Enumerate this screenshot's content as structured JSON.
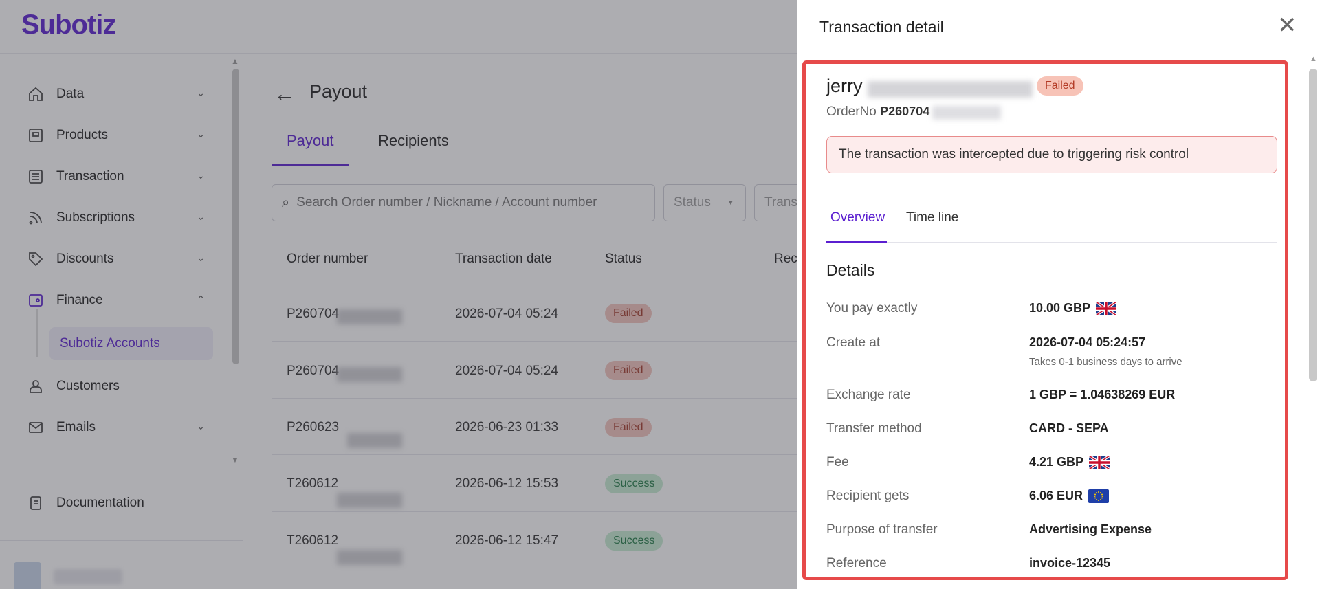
{
  "brand": {
    "name": "Subotiz"
  },
  "sidebar": {
    "items": [
      {
        "label": "Data"
      },
      {
        "label": "Products"
      },
      {
        "label": "Transaction"
      },
      {
        "label": "Subscriptions"
      },
      {
        "label": "Discounts"
      },
      {
        "label": "Finance"
      },
      {
        "label": "Customers"
      },
      {
        "label": "Emails"
      },
      {
        "label": "Documentation"
      }
    ],
    "sub_item": "Subotiz Accounts"
  },
  "main": {
    "title": "Payout",
    "tabs": [
      {
        "label": "Payout"
      },
      {
        "label": "Recipients"
      }
    ],
    "search_placeholder": "Search Order number / Nickname / Account number",
    "filters": [
      {
        "label": "Status"
      },
      {
        "label": "Trans"
      }
    ],
    "columns": [
      "Order number",
      "Transaction date",
      "Status",
      "Reci"
    ],
    "rows": [
      {
        "order": "P260704",
        "date": "2026-07-04 05:24",
        "status": "Failed"
      },
      {
        "order": "P260704",
        "date": "2026-07-04 05:24",
        "status": "Failed"
      },
      {
        "order": "P260623",
        "date": "2026-06-23 01:33",
        "status": "Failed"
      },
      {
        "order": "T260612",
        "date": "2026-06-12 15:53",
        "status": "Success"
      },
      {
        "order": "T260612",
        "date": "2026-06-12 15:47",
        "status": "Success"
      }
    ]
  },
  "panel": {
    "title": "Transaction detail",
    "name": "jerry",
    "status": "Failed",
    "order_label": "OrderNo",
    "order_value": "P260704",
    "alert": "The transaction was intercepted due to triggering risk control",
    "tabs": [
      {
        "label": "Overview"
      },
      {
        "label": "Time line"
      }
    ],
    "details_heading": "Details",
    "details": [
      {
        "label": "You pay exactly",
        "value": "10.00 GBP",
        "flag": "uk"
      },
      {
        "label": "Create at",
        "value": "2026-07-04 05:24:57",
        "sub": "Takes 0-1 business days to arrive"
      },
      {
        "label": "Exchange rate",
        "value": "1 GBP = 1.04638269 EUR"
      },
      {
        "label": "Transfer method",
        "value": "CARD - SEPA"
      },
      {
        "label": "Fee",
        "value": "4.21 GBP",
        "flag": "uk"
      },
      {
        "label": "Recipient gets",
        "value": "6.06 EUR",
        "flag": "eu"
      },
      {
        "label": "Purpose of transfer",
        "value": "Advertising Expense"
      },
      {
        "label": "Reference",
        "value": "invoice-12345"
      }
    ]
  },
  "colors": {
    "brand": "#5b1fd0",
    "failed": "#b33a25",
    "success": "#1f7a45",
    "highlight": "#e64a4a"
  }
}
